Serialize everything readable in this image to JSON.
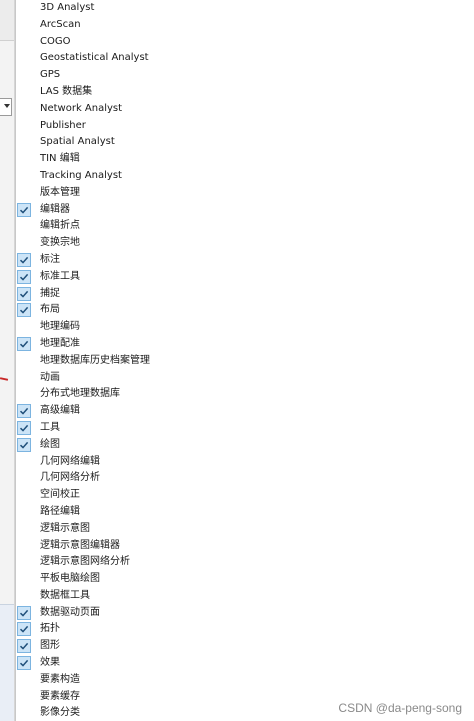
{
  "menu": {
    "items": [
      {
        "label": "3D Analyst",
        "checked": false
      },
      {
        "label": "ArcScan",
        "checked": false
      },
      {
        "label": "COGO",
        "checked": false
      },
      {
        "label": "Geostatistical Analyst",
        "checked": false
      },
      {
        "label": "GPS",
        "checked": false
      },
      {
        "label": "LAS 数据集",
        "checked": false
      },
      {
        "label": "Network Analyst",
        "checked": false
      },
      {
        "label": "Publisher",
        "checked": false
      },
      {
        "label": "Spatial Analyst",
        "checked": false
      },
      {
        "label": "TIN 编辑",
        "checked": false
      },
      {
        "label": "Tracking Analyst",
        "checked": false
      },
      {
        "label": "版本管理",
        "checked": false
      },
      {
        "label": "编辑器",
        "checked": true
      },
      {
        "label": "编辑折点",
        "checked": false
      },
      {
        "label": "变换宗地",
        "checked": false
      },
      {
        "label": "标注",
        "checked": true
      },
      {
        "label": "标准工具",
        "checked": true
      },
      {
        "label": "捕捉",
        "checked": true
      },
      {
        "label": "布局",
        "checked": true
      },
      {
        "label": "地理编码",
        "checked": false
      },
      {
        "label": "地理配准",
        "checked": true
      },
      {
        "label": "地理数据库历史档案管理",
        "checked": false
      },
      {
        "label": "动画",
        "checked": false
      },
      {
        "label": "分布式地理数据库",
        "checked": false
      },
      {
        "label": "高级编辑",
        "checked": true
      },
      {
        "label": "工具",
        "checked": true
      },
      {
        "label": "绘图",
        "checked": true
      },
      {
        "label": "几何网络编辑",
        "checked": false
      },
      {
        "label": "几何网络分析",
        "checked": false
      },
      {
        "label": "空间校正",
        "checked": false
      },
      {
        "label": "路径编辑",
        "checked": false
      },
      {
        "label": "逻辑示意图",
        "checked": false
      },
      {
        "label": "逻辑示意图编辑器",
        "checked": false
      },
      {
        "label": "逻辑示意图网络分析",
        "checked": false
      },
      {
        "label": "平板电脑绘图",
        "checked": false
      },
      {
        "label": "数据框工具",
        "checked": false
      },
      {
        "label": "数据驱动页面",
        "checked": true
      },
      {
        "label": "拓扑",
        "checked": true
      },
      {
        "label": "图形",
        "checked": true
      },
      {
        "label": "效果",
        "checked": true
      },
      {
        "label": "要素构造",
        "checked": false
      },
      {
        "label": "要素缓存",
        "checked": false
      },
      {
        "label": "影像分类",
        "checked": false
      }
    ]
  },
  "watermark": "CSDN @da-peng-song",
  "colors": {
    "check_bg": "#cce4f7",
    "check_border": "#7cb4e0",
    "check_mark": "#1f4f7a"
  },
  "icons": {
    "check": "checkmark-icon"
  }
}
